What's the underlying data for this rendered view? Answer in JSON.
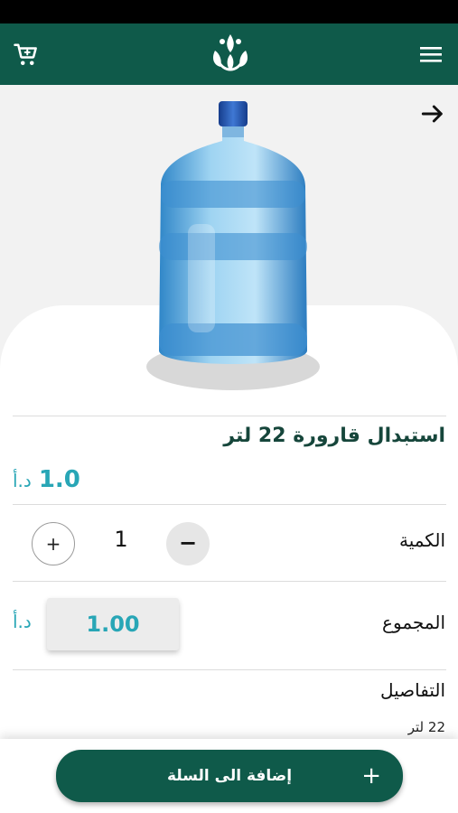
{
  "app_bar": {
    "cart_icon": "cart-icon",
    "menu_icon": "menu-icon",
    "logo": "brand-logo",
    "color": "#0f5a4a"
  },
  "hero": {
    "back_icon": "arrow-right-icon",
    "image": "water-bottle-22l"
  },
  "product": {
    "title": "استبدال قارورة 22 لتر",
    "price_amount": "1.0",
    "price_currency": "د.أ"
  },
  "quantity": {
    "label": "الكمية",
    "value": "1",
    "plus": "+",
    "minus": "−"
  },
  "total": {
    "label": "المجموع",
    "value": "1.00",
    "currency": "د.أ"
  },
  "details": {
    "label": "التفاصيل",
    "text": "22 لتر"
  },
  "add_to_cart": {
    "label": "إضافة الى السلة",
    "plus": "+"
  },
  "colors": {
    "primary": "#0f5a4a",
    "accent": "#28a6b6"
  }
}
